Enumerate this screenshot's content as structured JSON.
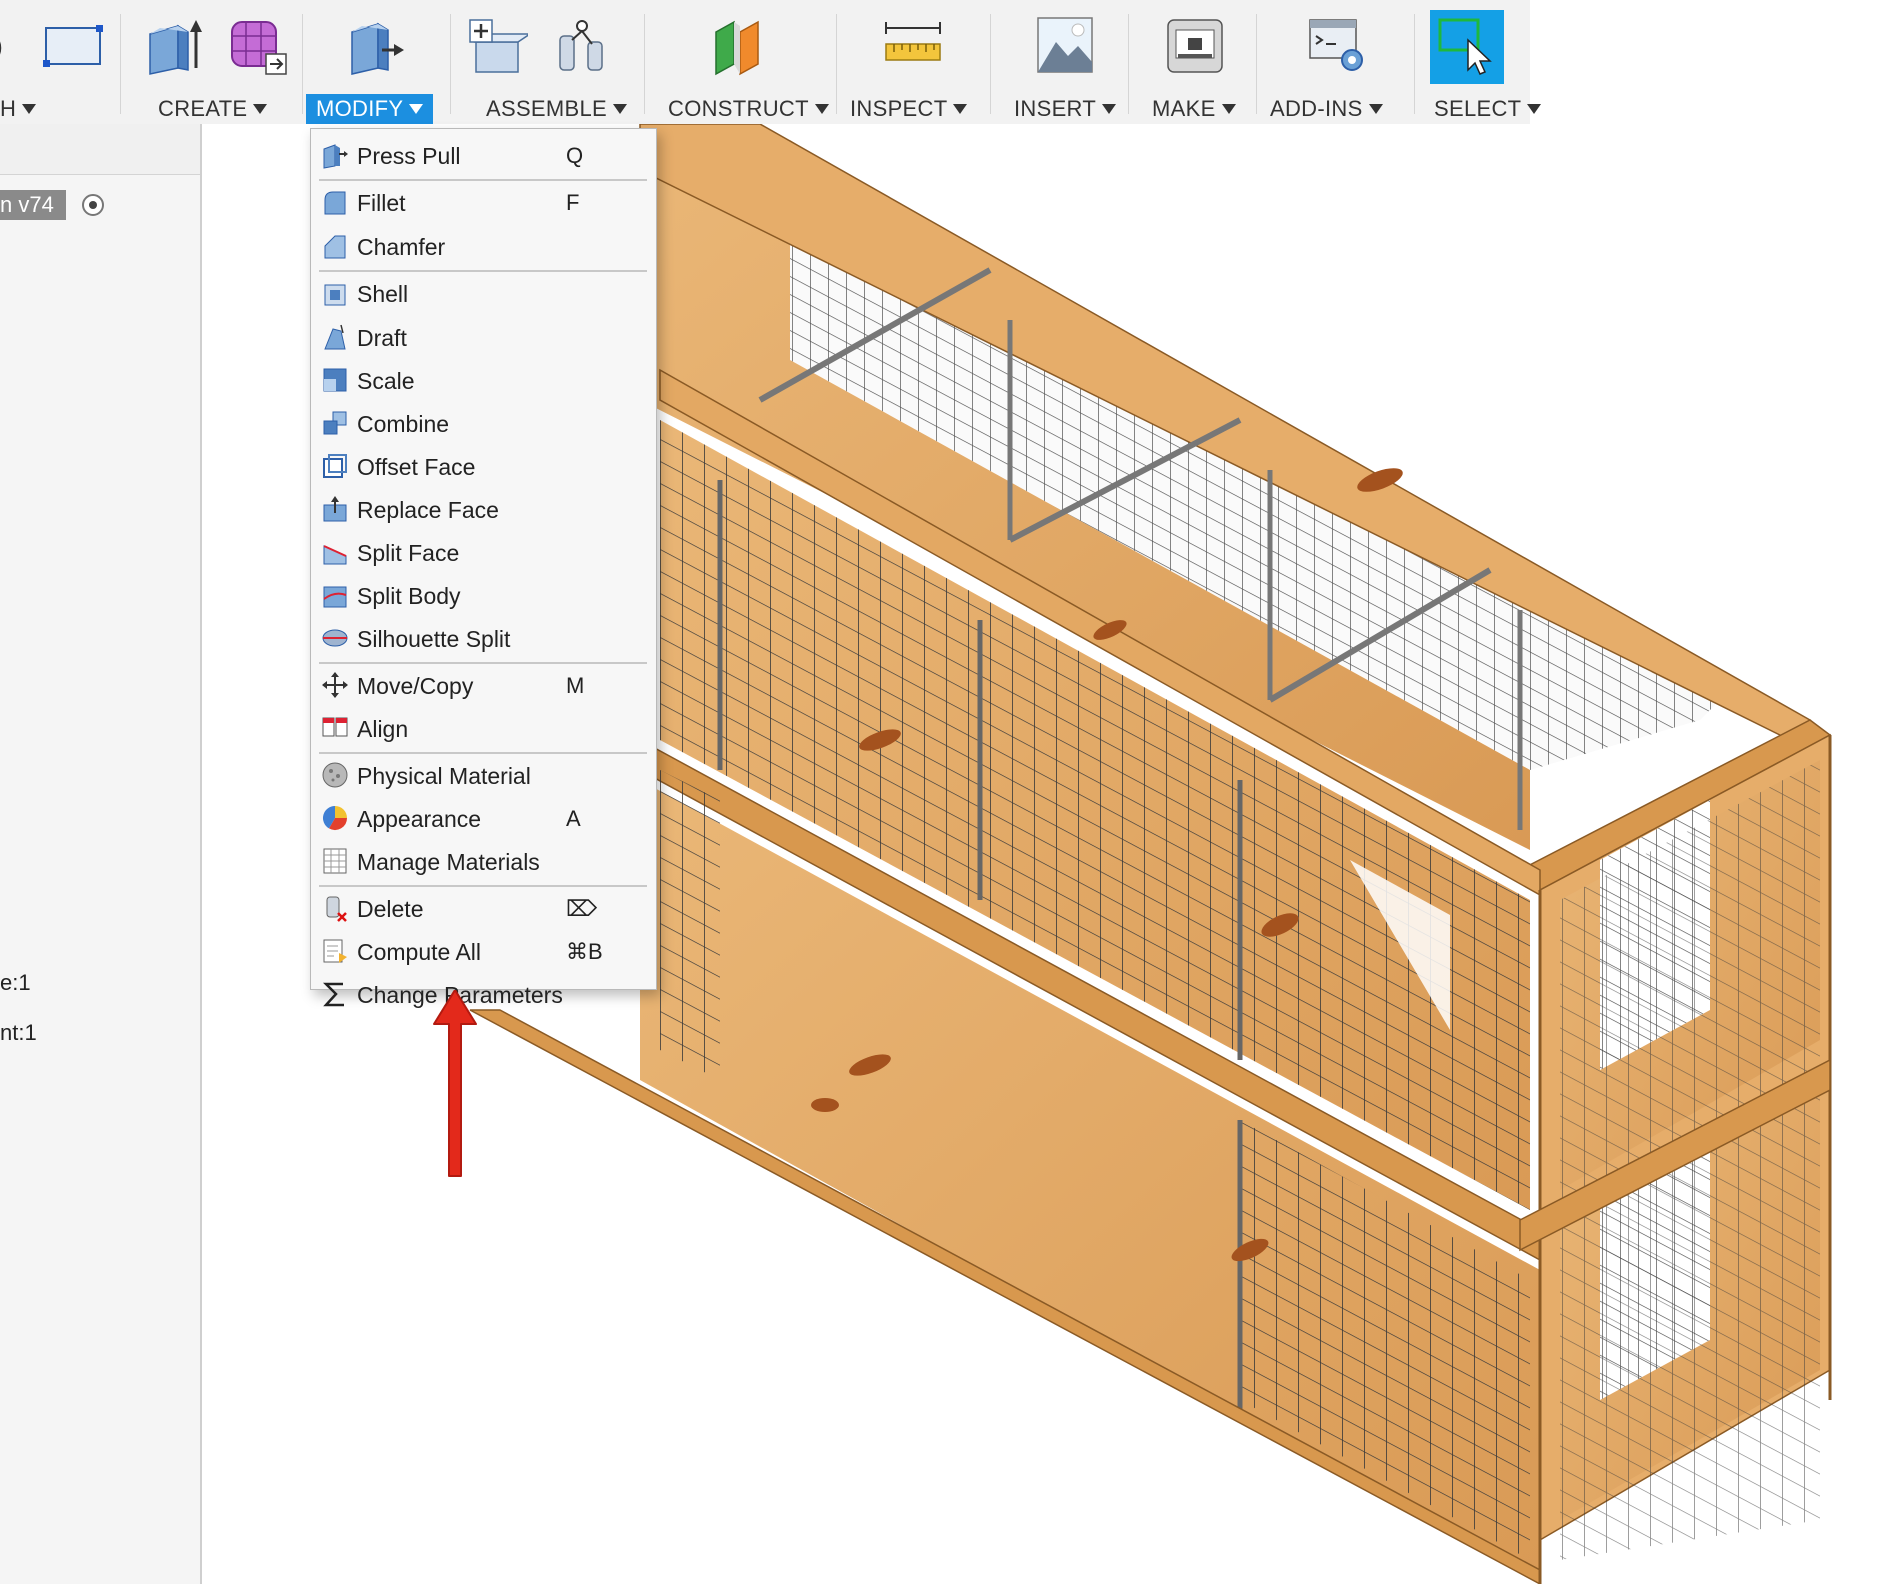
{
  "toolbar": {
    "partial_label": "H",
    "groups": [
      {
        "label": "CREATE"
      },
      {
        "label": "MODIFY"
      },
      {
        "label": "ASSEMBLE"
      },
      {
        "label": "CONSTRUCT"
      },
      {
        "label": "INSPECT"
      },
      {
        "label": "INSERT"
      },
      {
        "label": "MAKE"
      },
      {
        "label": "ADD-INS"
      },
      {
        "label": "SELECT"
      }
    ]
  },
  "left_panel": {
    "version_badge": "n v74",
    "text_1": "e:1",
    "text_2": "nt:1"
  },
  "modify_menu": {
    "items": [
      {
        "label": "Press Pull",
        "shortcut": "Q",
        "icon": "press-pull-icon"
      },
      {
        "label": "Fillet",
        "shortcut": "F",
        "icon": "fillet-icon"
      },
      {
        "label": "Chamfer",
        "shortcut": "",
        "icon": "chamfer-icon"
      },
      {
        "label": "Shell",
        "shortcut": "",
        "icon": "shell-icon"
      },
      {
        "label": "Draft",
        "shortcut": "",
        "icon": "draft-icon"
      },
      {
        "label": "Scale",
        "shortcut": "",
        "icon": "scale-icon"
      },
      {
        "label": "Combine",
        "shortcut": "",
        "icon": "combine-icon"
      },
      {
        "label": "Offset Face",
        "shortcut": "",
        "icon": "offset-face-icon"
      },
      {
        "label": "Replace Face",
        "shortcut": "",
        "icon": "replace-face-icon"
      },
      {
        "label": "Split Face",
        "shortcut": "",
        "icon": "split-face-icon"
      },
      {
        "label": "Split Body",
        "shortcut": "",
        "icon": "split-body-icon"
      },
      {
        "label": "Silhouette Split",
        "shortcut": "",
        "icon": "silhouette-split-icon"
      },
      {
        "label": "Move/Copy",
        "shortcut": "M",
        "icon": "move-copy-icon"
      },
      {
        "label": "Align",
        "shortcut": "",
        "icon": "align-icon"
      },
      {
        "label": "Physical Material",
        "shortcut": "",
        "icon": "physical-material-icon"
      },
      {
        "label": "Appearance",
        "shortcut": "A",
        "icon": "appearance-icon"
      },
      {
        "label": "Manage Materials",
        "shortcut": "",
        "icon": "manage-materials-icon"
      },
      {
        "label": "Delete",
        "shortcut": "⌦",
        "icon": "delete-icon"
      },
      {
        "label": "Compute All",
        "shortcut": "⌘B",
        "icon": "compute-all-icon"
      },
      {
        "label": "Change Parameters",
        "shortcut": "",
        "icon": "sigma-icon"
      }
    ]
  },
  "colors": {
    "accent": "#1c8fe0",
    "wood": "#e0a866",
    "wood_dark": "#c98a48",
    "mesh": "#555555",
    "arrow": "#e3291b"
  }
}
